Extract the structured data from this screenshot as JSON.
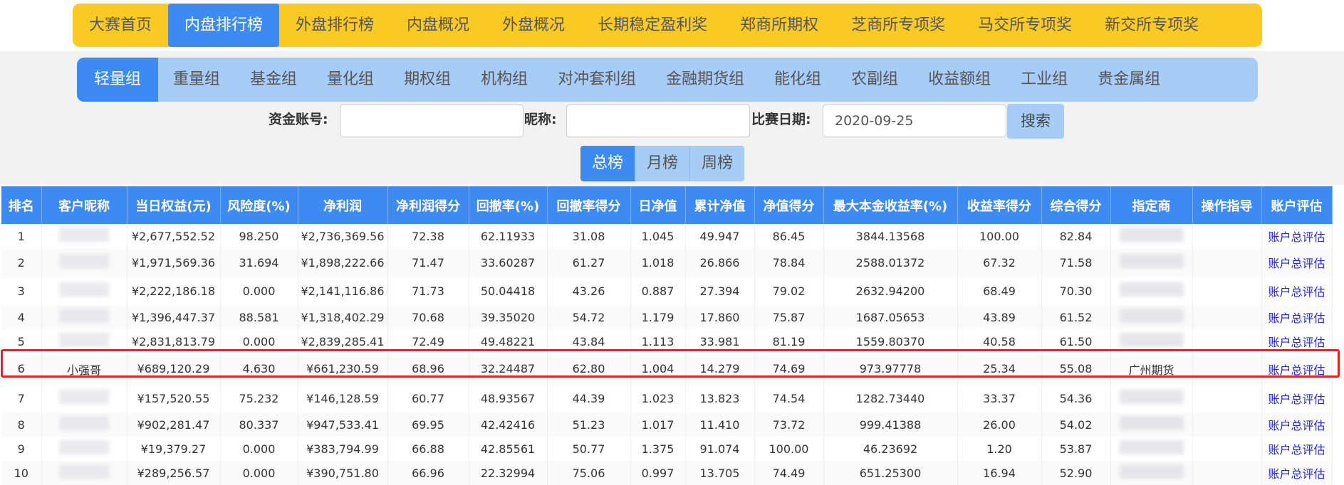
{
  "top_nav": [
    "大赛首页",
    "内盘排行榜",
    "外盘排行榜",
    "内盘概况",
    "外盘概况",
    "长期稳定盈利奖",
    "郑商所期权",
    "芝商所专项奖",
    "马交所专项奖",
    "新交所专项奖"
  ],
  "top_nav_active": "内盘排行榜",
  "groups": [
    "轻量组",
    "重量组",
    "基金组",
    "量化组",
    "期权组",
    "机构组",
    "对冲套利组",
    "金融期货组",
    "能化组",
    "农副组",
    "收益额组",
    "工业组",
    "贵金属组"
  ],
  "groups_active": "轻量组",
  "search": {
    "account_label": "资金账号:",
    "account_value": "",
    "nickname_label": "昵称:",
    "nickname_value": "",
    "date_label": "比赛日期:",
    "date_value": "2020-09-25",
    "button": "搜索"
  },
  "period_tabs": [
    "总榜",
    "月榜",
    "周榜"
  ],
  "period_active": "总榜",
  "table": {
    "headers": [
      "排名",
      "客户昵称",
      "当日权益(元)",
      "风险度(%)",
      "净利润",
      "净利润得分",
      "回撤率(%)",
      "回撤率得分",
      "日净值",
      "累计净值",
      "净值得分",
      "最大本金收益率(%)",
      "收益率得分",
      "综合得分",
      "指定商",
      "操作指导",
      "账户评估"
    ],
    "rows": [
      {
        "rank": "1",
        "nickname": "",
        "equity": "¥2,677,552.52",
        "risk": "98.250",
        "net_profit": "¥2,736,369.56",
        "profit_score": "72.38",
        "drawdown": "62.11933",
        "drawdown_score": "31.08",
        "daily_nav": "1.045",
        "cum_nav": "49.947",
        "nav_score": "86.45",
        "max_return": "3844.13568",
        "return_score": "100.00",
        "total_score": "82.84",
        "broker": "",
        "guidance": "",
        "eval": "账户总评估"
      },
      {
        "rank": "2",
        "nickname": "",
        "equity": "¥1,971,569.36",
        "risk": "31.694",
        "net_profit": "¥1,898,222.66",
        "profit_score": "71.47",
        "drawdown": "33.60287",
        "drawdown_score": "61.27",
        "daily_nav": "1.018",
        "cum_nav": "26.866",
        "nav_score": "78.84",
        "max_return": "2588.01372",
        "return_score": "67.32",
        "total_score": "71.58",
        "broker": "",
        "guidance": "",
        "eval": "账户总评估"
      },
      {
        "rank": "3",
        "nickname": "",
        "equity": "¥2,222,186.18",
        "risk": "0.000",
        "net_profit": "¥2,141,116.86",
        "profit_score": "71.73",
        "drawdown": "50.04418",
        "drawdown_score": "43.26",
        "daily_nav": "0.887",
        "cum_nav": "27.394",
        "nav_score": "79.02",
        "max_return": "2632.94200",
        "return_score": "68.49",
        "total_score": "70.30",
        "broker": "",
        "guidance": "",
        "eval": "账户总评估"
      },
      {
        "rank": "4",
        "nickname": "",
        "equity": "¥1,396,447.37",
        "risk": "88.581",
        "net_profit": "¥1,318,402.29",
        "profit_score": "70.68",
        "drawdown": "39.35020",
        "drawdown_score": "54.72",
        "daily_nav": "1.179",
        "cum_nav": "17.860",
        "nav_score": "75.87",
        "max_return": "1687.05653",
        "return_score": "43.89",
        "total_score": "61.52",
        "broker": "",
        "guidance": "",
        "eval": "账户总评估"
      },
      {
        "rank": "5",
        "nickname": "",
        "equity": "¥2,831,813.79",
        "risk": "0.000",
        "net_profit": "¥2,839,285.41",
        "profit_score": "72.49",
        "drawdown": "49.48221",
        "drawdown_score": "43.84",
        "daily_nav": "1.113",
        "cum_nav": "33.981",
        "nav_score": "81.19",
        "max_return": "1559.80370",
        "return_score": "40.58",
        "total_score": "61.50",
        "broker": "",
        "guidance": "",
        "eval": "账户总评估"
      },
      {
        "rank": "6",
        "nickname": "小强哥",
        "equity": "¥689,120.29",
        "risk": "4.630",
        "net_profit": "¥661,230.59",
        "profit_score": "68.96",
        "drawdown": "32.24487",
        "drawdown_score": "62.80",
        "daily_nav": "1.004",
        "cum_nav": "14.279",
        "nav_score": "74.69",
        "max_return": "973.97778",
        "return_score": "25.34",
        "total_score": "55.08",
        "broker": "广州期货",
        "guidance": "",
        "eval": "账户总评估"
      },
      {
        "rank": "7",
        "nickname": "",
        "equity": "¥157,520.55",
        "risk": "75.232",
        "net_profit": "¥146,128.59",
        "profit_score": "60.77",
        "drawdown": "48.93567",
        "drawdown_score": "44.39",
        "daily_nav": "1.023",
        "cum_nav": "13.823",
        "nav_score": "74.54",
        "max_return": "1282.73440",
        "return_score": "33.37",
        "total_score": "54.36",
        "broker": "",
        "guidance": "",
        "eval": "账户总评估"
      },
      {
        "rank": "8",
        "nickname": "",
        "equity": "¥902,281.47",
        "risk": "80.337",
        "net_profit": "¥947,533.41",
        "profit_score": "69.95",
        "drawdown": "42.42416",
        "drawdown_score": "51.23",
        "daily_nav": "1.017",
        "cum_nav": "11.410",
        "nav_score": "73.72",
        "max_return": "999.41388",
        "return_score": "26.00",
        "total_score": "54.02",
        "broker": "",
        "guidance": "",
        "eval": "账户总评估"
      },
      {
        "rank": "9",
        "nickname": "",
        "equity": "¥19,379.27",
        "risk": "0.000",
        "net_profit": "¥383,794.99",
        "profit_score": "66.88",
        "drawdown": "42.85561",
        "drawdown_score": "50.77",
        "daily_nav": "1.375",
        "cum_nav": "91.074",
        "nav_score": "100.00",
        "max_return": "46.23692",
        "return_score": "1.20",
        "total_score": "53.87",
        "broker": "",
        "guidance": "",
        "eval": "账户总评估"
      },
      {
        "rank": "10",
        "nickname": "",
        "equity": "¥289,256.57",
        "risk": "0.000",
        "net_profit": "¥390,751.80",
        "profit_score": "66.96",
        "drawdown": "22.32994",
        "drawdown_score": "75.06",
        "daily_nav": "0.997",
        "cum_nav": "13.705",
        "nav_score": "74.49",
        "max_return": "651.25300",
        "return_score": "16.94",
        "total_score": "52.90",
        "broker": "",
        "guidance": "",
        "eval": "账户总评估"
      }
    ],
    "highlighted_rank": "6"
  },
  "colors": {
    "nav_yellow": "#f9ca24",
    "active_blue": "#3d8bf2",
    "light_blue": "#a7ccf6",
    "highlight_red": "#e52222"
  }
}
